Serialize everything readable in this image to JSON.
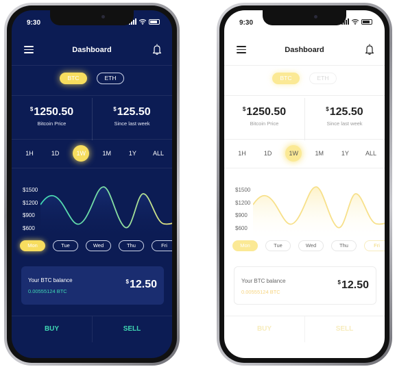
{
  "colors": {
    "dark_bg": "#0c1c54",
    "dark_card": "#1a2d70",
    "accent_yellow": "#f7dd5f",
    "accent_green": "#3fd8b4",
    "light_bg": "#ffffff"
  },
  "screens": [
    {
      "theme": "dark",
      "status": {
        "time": "9:30"
      },
      "header": {
        "title": "Dashboard",
        "menu_icon": "menu-icon",
        "bell_icon": "bell-icon"
      },
      "coins": [
        {
          "label": "BTC",
          "selected": true
        },
        {
          "label": "ETH",
          "selected": false
        }
      ],
      "stats": [
        {
          "currency": "$",
          "value": "1250.50",
          "label": "Bitcoin Price"
        },
        {
          "currency": "$",
          "value": "125.50",
          "label": "Since last week"
        }
      ],
      "periods": [
        "1H",
        "1D",
        "1W",
        "1M",
        "1Y",
        "ALL"
      ],
      "selected_period": "1W",
      "y_ticks": [
        "$1500",
        "$1200",
        "$900",
        "$600"
      ],
      "days": [
        "Mon",
        "Tue",
        "Wed",
        "Thu",
        "Fri"
      ],
      "selected_day": "Mon",
      "balance": {
        "label": "Your BTC balance",
        "btc": "0.00555124 BTC",
        "currency": "$",
        "usd": "12.50"
      },
      "actions": {
        "buy": "BUY",
        "sell": "SELL"
      }
    },
    {
      "theme": "light",
      "status": {
        "time": "9:30"
      },
      "header": {
        "title": "Dashboard",
        "menu_icon": "menu-icon",
        "bell_icon": "bell-icon"
      },
      "coins": [
        {
          "label": "BTC",
          "selected": true
        },
        {
          "label": "ETH",
          "selected": false
        }
      ],
      "stats": [
        {
          "currency": "$",
          "value": "1250.50",
          "label": "Bitcoin Price"
        },
        {
          "currency": "$",
          "value": "125.50",
          "label": "Since last week"
        }
      ],
      "periods": [
        "1H",
        "1D",
        "1W",
        "1M",
        "1Y",
        "ALL"
      ],
      "selected_period": "1W",
      "y_ticks": [
        "$1500",
        "$1200",
        "$900",
        "$600"
      ],
      "days": [
        "Mon",
        "Tue",
        "Wed",
        "Thu",
        "Fri"
      ],
      "selected_day": "Mon",
      "balance": {
        "label": "Your BTC balance",
        "btc": "0.00555124 BTC",
        "currency": "$",
        "usd": "12.50"
      },
      "actions": {
        "buy": "BUY",
        "sell": "SELL"
      }
    }
  ]
}
